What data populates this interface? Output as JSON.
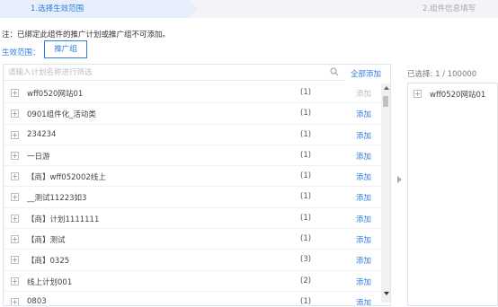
{
  "steps": {
    "active": "1.选择生效范围",
    "next": "2.组件信息填写"
  },
  "note": "注：已绑定此组件的推广计划或推广组不可添加。",
  "scope": {
    "label": "生效范围：",
    "value": "推广组"
  },
  "search": {
    "placeholder": "请输入计划名称进行筛选",
    "icon": "search-icon"
  },
  "add_all_label": "全部添加",
  "colors": {
    "accent": "#2f7de1",
    "disabled": "#bdbdbd"
  },
  "list": [
    {
      "name": "wff0520网站01",
      "count": "(1)",
      "action": "添加",
      "disabled": true
    },
    {
      "name": "0901组件化_活动类",
      "count": "(1)",
      "action": "添加",
      "disabled": false
    },
    {
      "name": "234234",
      "count": "(1)",
      "action": "添加",
      "disabled": false
    },
    {
      "name": "一日游",
      "count": "(1)",
      "action": "添加",
      "disabled": false
    },
    {
      "name": "【商】wff052002线上",
      "count": "(1)",
      "action": "添加",
      "disabled": false
    },
    {
      "name": "__测试11223如3",
      "count": "(1)",
      "action": "添加",
      "disabled": false
    },
    {
      "name": "【商】计划1111111",
      "count": "(1)",
      "action": "添加",
      "disabled": false
    },
    {
      "name": "【商】测试",
      "count": "(1)",
      "action": "添加",
      "disabled": false
    },
    {
      "name": "【商】0325",
      "count": "(3)",
      "action": "添加",
      "disabled": false
    },
    {
      "name": "线上计划001",
      "count": "(2)",
      "action": "添加",
      "disabled": false
    },
    {
      "name": "0803",
      "count": "(1)",
      "action": "添加",
      "disabled": false
    }
  ],
  "selected": {
    "header": "已选择: 1 / 100000",
    "items": [
      "wff0520网站01"
    ]
  }
}
